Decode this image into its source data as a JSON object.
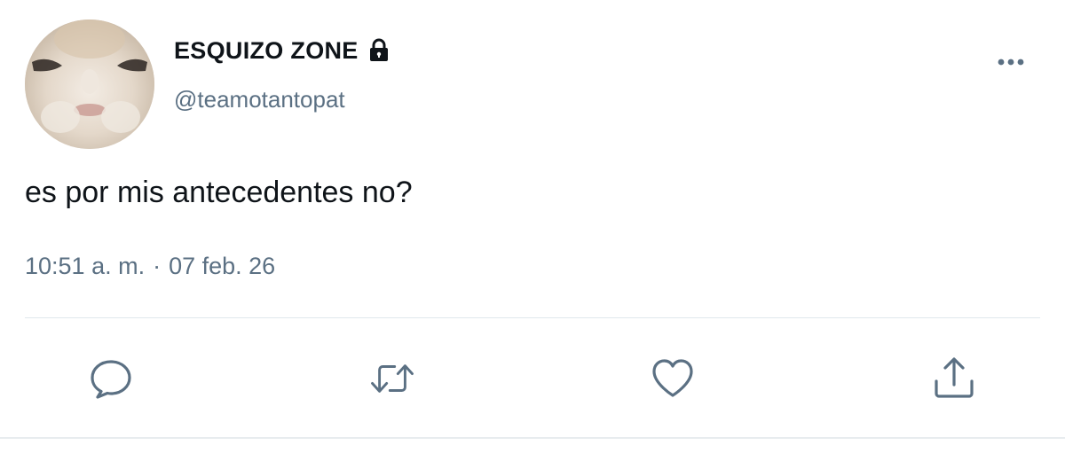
{
  "tweet": {
    "display_name": "ESQUIZO ZONE",
    "handle": "@teamotantopat",
    "text": "es por mis antecedentes no?",
    "time": "10:51 a. m.",
    "separator": "·",
    "date": "07 feb. 26",
    "protected_icon": "lock-icon",
    "avatar_icon": "avatar"
  },
  "actions": [
    {
      "name": "reply",
      "icon": "comment-icon"
    },
    {
      "name": "retweet",
      "icon": "retweet-icon"
    },
    {
      "name": "like",
      "icon": "heart-icon"
    },
    {
      "name": "share",
      "icon": "share-icon"
    }
  ],
  "colors": {
    "text_primary": "#0f1419",
    "text_secondary": "#5b7083",
    "icon": "#5b7083",
    "divider": "#e1e8ed"
  }
}
